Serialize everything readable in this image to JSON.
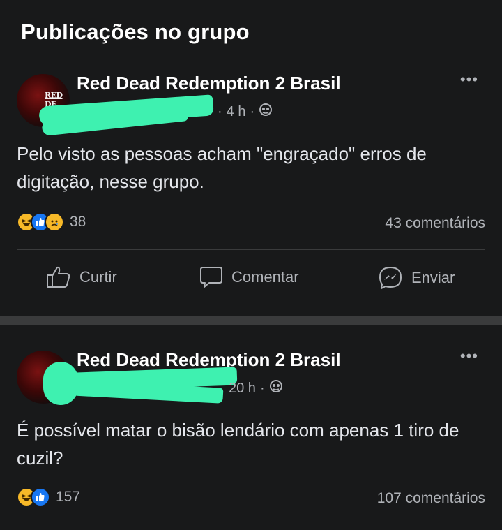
{
  "header": {
    "title": "Publicações no grupo"
  },
  "posts": [
    {
      "group_name": "Red Dead Redemption 2 Brasil",
      "avatar_text": "RED DE",
      "time": "4 h",
      "privacy_icon": "globe-icon",
      "more_label": "•••",
      "text": "Pelo visto as pessoas acham \"engraçado\" erros de digitação, nesse grupo.",
      "reaction_icons": [
        "haha-icon",
        "like-icon",
        "sad-icon"
      ],
      "reactions_count": "38",
      "comments": "43 comentários",
      "actions": {
        "like": "Curtir",
        "comment": "Comentar",
        "send": "Enviar"
      }
    },
    {
      "group_name": "Red Dead Redemption 2 Brasil",
      "time": "20 h",
      "privacy_icon": "globe-icon",
      "more_label": "•••",
      "text": "É possível matar o bisão lendário com apenas 1 tiro de cuzil?",
      "reaction_icons": [
        "haha-icon",
        "like-icon"
      ],
      "reactions_count": "157",
      "comments": "107 comentários"
    }
  ],
  "colors": {
    "background": "#18191a",
    "divider": "#3a3b3c",
    "secondary_text": "#b0b3b8",
    "redaction": "#3ef1b0",
    "like_blue": "#1877f2",
    "haha_yellow": "#f7b928"
  }
}
